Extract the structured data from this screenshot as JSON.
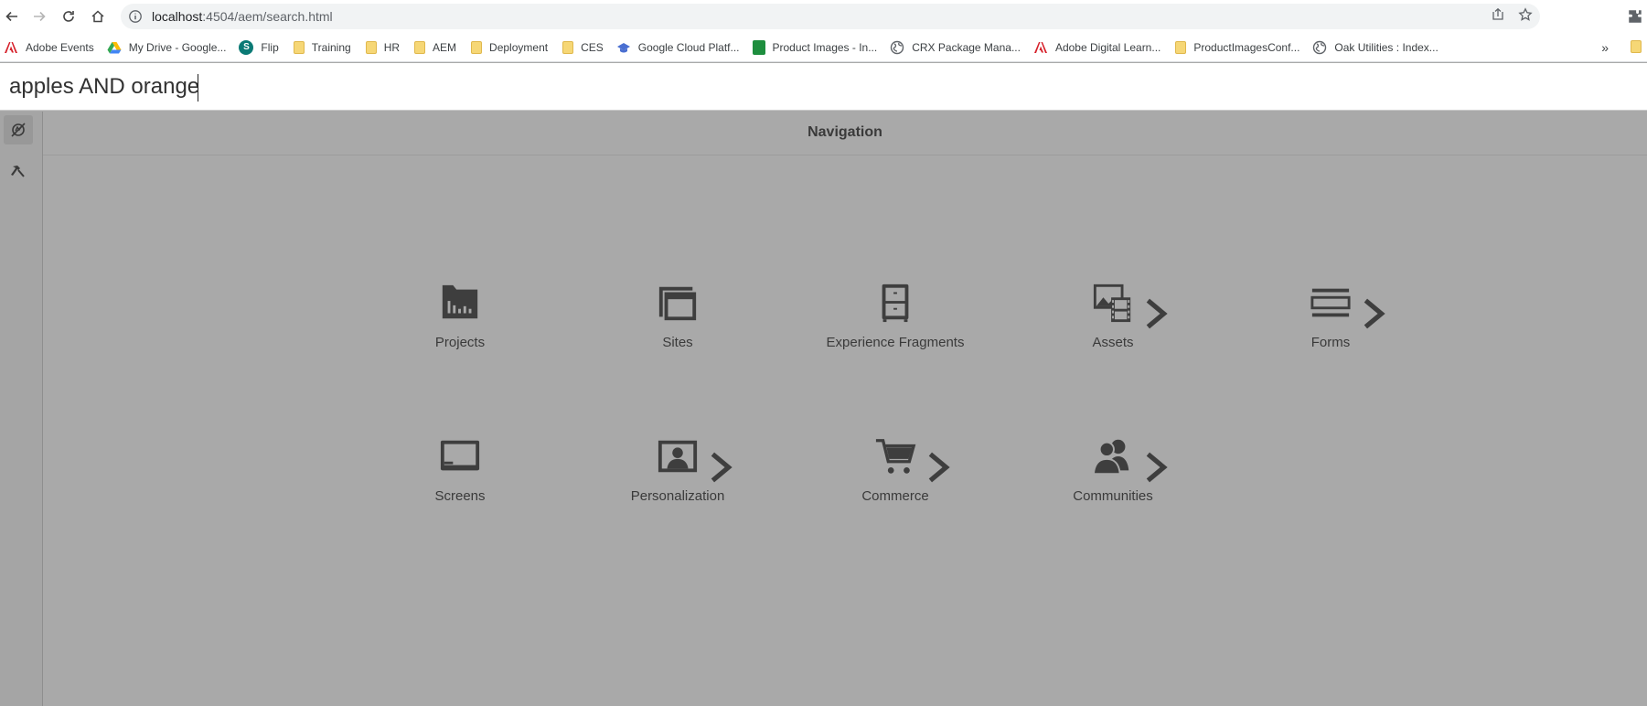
{
  "browser": {
    "url_host": "localhost",
    "url_path": ":4504/aem/search.html",
    "bookmarks": [
      {
        "label": "Adobe Events",
        "icon": "adobe-icon"
      },
      {
        "label": "My Drive - Google...",
        "icon": "google-drive-icon"
      },
      {
        "label": "Flip",
        "icon": "sharepoint-icon"
      },
      {
        "label": "Training",
        "icon": "folder-icon"
      },
      {
        "label": "HR",
        "icon": "folder-icon"
      },
      {
        "label": "AEM",
        "icon": "folder-icon"
      },
      {
        "label": "Deployment",
        "icon": "folder-icon"
      },
      {
        "label": "CES",
        "icon": "folder-icon"
      },
      {
        "label": "Google Cloud Platf...",
        "icon": "cap-icon"
      },
      {
        "label": "Product Images - In...",
        "icon": "sheets-icon"
      },
      {
        "label": "CRX Package Mana...",
        "icon": "globe-icon"
      },
      {
        "label": "Adobe Digital Learn...",
        "icon": "adobe-icon"
      },
      {
        "label": "ProductImagesConf...",
        "icon": "folder-icon"
      },
      {
        "label": "Oak Utilities : Index...",
        "icon": "globe-icon"
      }
    ],
    "bookmarks_more": "»"
  },
  "search": {
    "value": "apples AND orange"
  },
  "navigation": {
    "title": "Navigation",
    "tiles": [
      {
        "label": "Projects",
        "icon": "projects-icon",
        "has_chevron": false
      },
      {
        "label": "Sites",
        "icon": "sites-icon",
        "has_chevron": false
      },
      {
        "label": "Experience Fragments",
        "icon": "experience-fragments-icon",
        "has_chevron": false
      },
      {
        "label": "Assets",
        "icon": "assets-icon",
        "has_chevron": true
      },
      {
        "label": "Forms",
        "icon": "forms-icon",
        "has_chevron": true
      },
      {
        "label": "Screens",
        "icon": "screens-icon",
        "has_chevron": false
      },
      {
        "label": "Personalization",
        "icon": "personalization-icon",
        "has_chevron": true
      },
      {
        "label": "Commerce",
        "icon": "commerce-icon",
        "has_chevron": true
      },
      {
        "label": "Communities",
        "icon": "communities-icon",
        "has_chevron": true
      }
    ]
  },
  "colors": {
    "overlay_background": "#a9a9a9",
    "icon_color": "#3e3e3e"
  }
}
